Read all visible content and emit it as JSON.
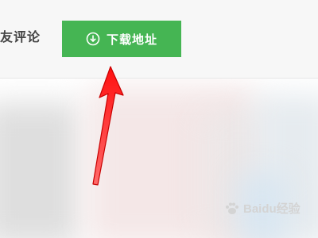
{
  "header": {
    "reviews_tab_label": "友评论",
    "download_button": {
      "label": "下载地址",
      "icon": "download-icon",
      "color": "#45b553"
    }
  },
  "watermark": {
    "text": "Baidu经验",
    "icon": "paw-icon"
  },
  "annotation": {
    "arrow_color": "#ff1a1a"
  }
}
